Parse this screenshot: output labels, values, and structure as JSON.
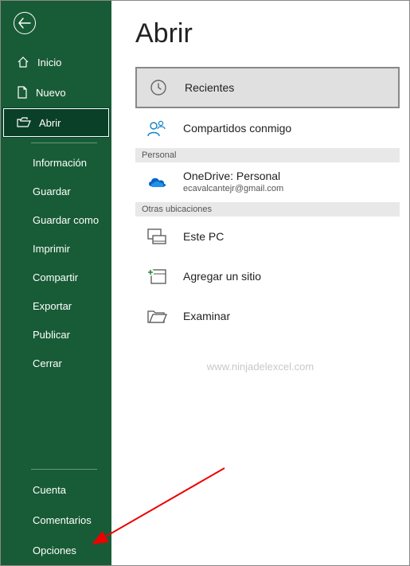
{
  "sidebar": {
    "top": [
      {
        "label": "Inicio",
        "icon": "home-icon"
      },
      {
        "label": "Nuevo",
        "icon": "new-icon"
      },
      {
        "label": "Abrir",
        "icon": "open-icon",
        "selected": true
      }
    ],
    "middle": [
      {
        "label": "Información"
      },
      {
        "label": "Guardar"
      },
      {
        "label": "Guardar como"
      },
      {
        "label": "Imprimir"
      },
      {
        "label": "Compartir"
      },
      {
        "label": "Exportar"
      },
      {
        "label": "Publicar"
      },
      {
        "label": "Cerrar"
      }
    ],
    "bottom": [
      {
        "label": "Cuenta"
      },
      {
        "label": "Comentarios"
      },
      {
        "label": "Opciones"
      }
    ]
  },
  "main": {
    "title": "Abrir",
    "items": [
      {
        "label": "Recientes",
        "icon": "clock-icon",
        "selected": true
      },
      {
        "label": "Compartidos conmigo",
        "icon": "shared-icon"
      }
    ],
    "sections": [
      {
        "header": "Personal",
        "items": [
          {
            "label": "OneDrive: Personal",
            "sub": "ecavalcantejr@gmail.com",
            "icon": "onedrive-icon"
          }
        ]
      },
      {
        "header": "Otras ubicaciones",
        "items": [
          {
            "label": "Este PC",
            "icon": "thispc-icon"
          },
          {
            "label": "Agregar un sitio",
            "icon": "addsite-icon"
          },
          {
            "label": "Examinar",
            "icon": "browse-icon"
          }
        ]
      }
    ]
  },
  "watermark": "www.ninjadelexcel.com"
}
